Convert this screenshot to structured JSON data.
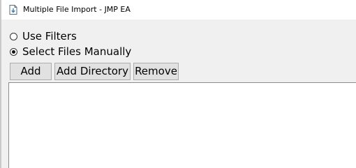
{
  "window": {
    "title": "Multiple File Import - JMP EA",
    "icon": "file-import-icon"
  },
  "selection_mode": {
    "options": [
      {
        "label": "Use Filters",
        "checked": false
      },
      {
        "label": "Select Files Manually",
        "checked": true
      }
    ]
  },
  "toolbar": {
    "add_label": "Add",
    "add_directory_label": "Add Directory",
    "remove_label": "Remove"
  },
  "file_list": {
    "items": []
  },
  "colors": {
    "window_background": "#f0f0f0",
    "button_background": "#e1e1e1",
    "button_border": "#adadad",
    "list_background": "#ffffff"
  }
}
